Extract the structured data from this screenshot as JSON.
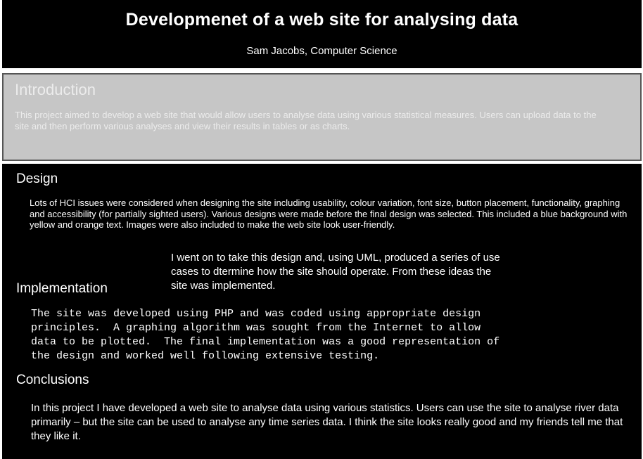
{
  "header": {
    "title": "Developmenet of a web site for analysing data",
    "author": "Sam Jacobs, Computer Science"
  },
  "introduction": {
    "heading": "Introduction",
    "body": "This project aimed to develop a web site that would allow users to analyse data using various statistical measures.  Users can upload data to the site and then perform various analyses and view their results in tables or as charts."
  },
  "design": {
    "heading": "Design",
    "body": "Lots of HCI issues were considered when designing the site including usability, colour variation, font size, button placement, functionality, graphing and accessibility (for partially sighted users).  Various designs were made before the final design was selected.  This included a blue background with yellow and orange text.  Images were also included to make the web site look user-friendly.",
    "note": "I went on to take this design and, using UML, produced a series of use cases to dtermine how the site should operate. From these ideas the site was implemented."
  },
  "implementation": {
    "heading": "Implementation",
    "body": "The site was developed using PHP and was coded using appropriate design\nprinciples.  A graphing algorithm was sought from the Internet to allow\ndata to be plotted.  The final implementation was a good representation of\nthe design and worked well following extensive testing."
  },
  "conclusions": {
    "heading": "Conclusions",
    "body": "In this project I have developed a web site to analyse data using various statistics.  Users can use the site to analyse river data primarily – but the site can be used to analyse any time series data.  I think the site looks really good and my friends tell me that they like it."
  },
  "colors": {
    "dark_background": "#000000",
    "intro_background": "#c6c6c6",
    "intro_text": "#ececec",
    "text_on_dark": "#ffffff"
  }
}
